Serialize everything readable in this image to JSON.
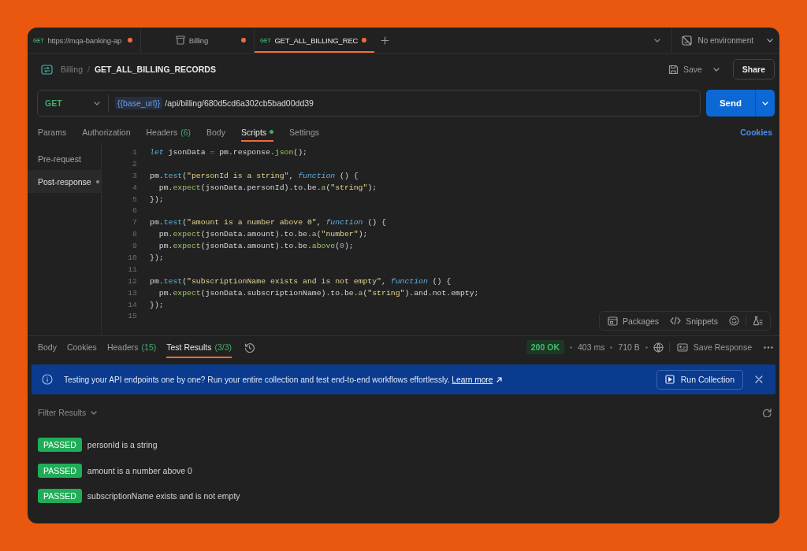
{
  "tabs": [
    {
      "kind": "request",
      "method": "GET",
      "title": "https://mqa-banking-ap",
      "unsaved": true,
      "selected": false
    },
    {
      "kind": "collection",
      "title": "Billing",
      "unsaved": true,
      "selected": false
    },
    {
      "kind": "request",
      "method": "GET",
      "title": "GET_ALL_BILLING_REC",
      "unsaved": true,
      "selected": true
    }
  ],
  "environment": {
    "label": "No environment"
  },
  "breadcrumb": {
    "collection": "Billing",
    "separator": "/",
    "request": "GET_ALL_BILLING_RECORDS"
  },
  "header_actions": {
    "save": "Save",
    "share": "Share"
  },
  "url_bar": {
    "method": "GET",
    "variable": "{{base_url}}",
    "path": "/api/billing/680d5cd6a302cb5bad00dd39",
    "send": "Send"
  },
  "request_tabs": [
    {
      "label": "Params",
      "has_content": false,
      "selected": false
    },
    {
      "label": "Authorization",
      "has_content": false,
      "selected": false
    },
    {
      "label": "Headers",
      "count": "(6)",
      "has_content": false,
      "selected": false
    },
    {
      "label": "Body",
      "has_content": false,
      "selected": false
    },
    {
      "label": "Scripts",
      "has_content": true,
      "selected": true
    },
    {
      "label": "Settings",
      "has_content": false,
      "selected": false
    }
  ],
  "cookies_link": "Cookies",
  "script_phases": [
    {
      "label": "Pre-request",
      "has_content": false,
      "selected": false
    },
    {
      "label": "Post-response",
      "has_content": true,
      "selected": true
    }
  ],
  "code": [
    {
      "number": "1",
      "tokens": [
        {
          "kind": "keyword",
          "text": "let"
        },
        {
          "kind": "plain",
          "text": " jsonData "
        },
        {
          "kind": "operator",
          "text": "="
        },
        {
          "kind": "plain",
          "text": " pm.response."
        },
        {
          "kind": "method",
          "text": "json"
        },
        {
          "kind": "plain",
          "text": "();"
        }
      ]
    },
    {
      "number": "2"
    },
    {
      "number": "3",
      "tokens": [
        {
          "kind": "plain",
          "text": "pm."
        },
        {
          "kind": "call",
          "text": "test"
        },
        {
          "kind": "plain",
          "text": "("
        },
        {
          "kind": "string",
          "text": "\"personId is a string\""
        },
        {
          "kind": "plain",
          "text": ", "
        },
        {
          "kind": "keyword",
          "text": "function"
        },
        {
          "kind": "plain",
          "text": " () {"
        }
      ]
    },
    {
      "number": "4",
      "tokens": [
        {
          "kind": "plain",
          "text": "  pm."
        },
        {
          "kind": "method",
          "text": "expect"
        },
        {
          "kind": "plain",
          "text": "(jsonData.personId).to.be."
        },
        {
          "kind": "method",
          "text": "a"
        },
        {
          "kind": "plain",
          "text": "("
        },
        {
          "kind": "string",
          "text": "\"string\""
        },
        {
          "kind": "plain",
          "text": ");"
        }
      ]
    },
    {
      "number": "5",
      "tokens": [
        {
          "kind": "plain",
          "text": "});"
        }
      ]
    },
    {
      "number": "6"
    },
    {
      "number": "7",
      "tokens": [
        {
          "kind": "plain",
          "text": "pm."
        },
        {
          "kind": "call",
          "text": "test"
        },
        {
          "kind": "plain",
          "text": "("
        },
        {
          "kind": "string",
          "text": "\"amount is a number above 0\""
        },
        {
          "kind": "plain",
          "text": ", "
        },
        {
          "kind": "keyword",
          "text": "function"
        },
        {
          "kind": "plain",
          "text": " () {"
        }
      ]
    },
    {
      "number": "8",
      "tokens": [
        {
          "kind": "plain",
          "text": "  pm."
        },
        {
          "kind": "method",
          "text": "expect"
        },
        {
          "kind": "plain",
          "text": "(jsonData.amount).to.be."
        },
        {
          "kind": "method",
          "text": "a"
        },
        {
          "kind": "plain",
          "text": "("
        },
        {
          "kind": "string",
          "text": "\"number\""
        },
        {
          "kind": "plain",
          "text": ");"
        }
      ]
    },
    {
      "number": "9",
      "tokens": [
        {
          "kind": "plain",
          "text": "  pm."
        },
        {
          "kind": "method",
          "text": "expect"
        },
        {
          "kind": "plain",
          "text": "(jsonData.amount).to.be."
        },
        {
          "kind": "method",
          "text": "above"
        },
        {
          "kind": "plain",
          "text": "("
        },
        {
          "kind": "number",
          "text": "0"
        },
        {
          "kind": "plain",
          "text": ");"
        }
      ]
    },
    {
      "number": "10",
      "tokens": [
        {
          "kind": "plain",
          "text": "});"
        }
      ]
    },
    {
      "number": "11"
    },
    {
      "number": "12",
      "tokens": [
        {
          "kind": "plain",
          "text": "pm."
        },
        {
          "kind": "call",
          "text": "test"
        },
        {
          "kind": "plain",
          "text": "("
        },
        {
          "kind": "string",
          "text": "\"subscriptionName exists and is not empty\""
        },
        {
          "kind": "plain",
          "text": ", "
        },
        {
          "kind": "keyword",
          "text": "function"
        },
        {
          "kind": "plain",
          "text": " () {"
        }
      ]
    },
    {
      "number": "13",
      "tokens": [
        {
          "kind": "plain",
          "text": "  pm."
        },
        {
          "kind": "method",
          "text": "expect"
        },
        {
          "kind": "plain",
          "text": "(jsonData.subscriptionName).to.be."
        },
        {
          "kind": "method",
          "text": "a"
        },
        {
          "kind": "plain",
          "text": "("
        },
        {
          "kind": "string",
          "text": "\"string\""
        },
        {
          "kind": "plain",
          "text": ").and.not.empty;"
        }
      ]
    },
    {
      "number": "14",
      "tokens": [
        {
          "kind": "plain",
          "text": "});"
        }
      ]
    },
    {
      "number": "15"
    }
  ],
  "editor_tools": {
    "packages": "Packages",
    "snippets": "Snippets"
  },
  "response_tabs": [
    {
      "label": "Body",
      "selected": false
    },
    {
      "label": "Cookies",
      "selected": false
    },
    {
      "label": "Headers",
      "count": "(15)",
      "selected": false
    },
    {
      "label": "Test Results",
      "count": "(3/3)",
      "selected": true
    }
  ],
  "response_meta": {
    "status": "200 OK",
    "time": "403 ms",
    "size": "710 B",
    "save": "Save Response"
  },
  "banner": {
    "text": "Testing your API endpoints one by one? Run your entire collection and test end-to-end workflows effortlessly.",
    "link": "Learn more",
    "button": "Run Collection"
  },
  "filter": {
    "label": "Filter Results"
  },
  "results": [
    {
      "status": "PASSED",
      "passed": true,
      "name": "personId is a string"
    },
    {
      "status": "PASSED",
      "passed": true,
      "name": "amount is a number above 0"
    },
    {
      "status": "PASSED",
      "passed": true,
      "name": "subscriptionName exists and is not empty"
    }
  ]
}
